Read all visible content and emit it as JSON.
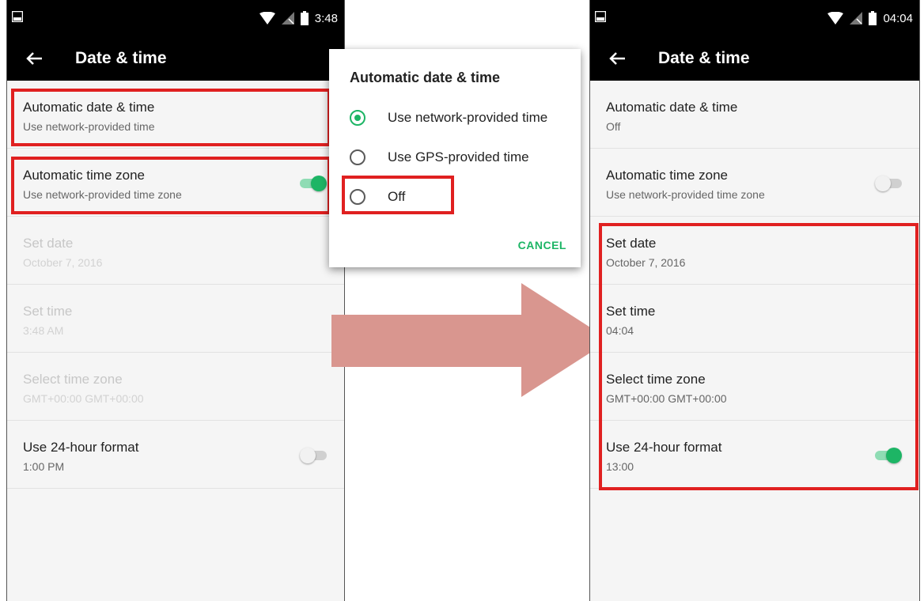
{
  "colors": {
    "accent": "#1db565",
    "highlight": "#e02020",
    "arrow": "#d9968f",
    "statusbar": "#000000"
  },
  "left_screen": {
    "status_time": "3:48",
    "title": "Date & time",
    "items": [
      {
        "title": "Automatic date & time",
        "subtitle": "Use network-provided time"
      },
      {
        "title": "Automatic time zone",
        "subtitle": "Use network-provided time zone",
        "toggle": "on"
      },
      {
        "title": "Set date",
        "subtitle": "October 7, 2016",
        "disabled": true
      },
      {
        "title": "Set time",
        "subtitle": "3:48 AM",
        "disabled": true
      },
      {
        "title": "Select time zone",
        "subtitle": "GMT+00:00 GMT+00:00",
        "disabled": true
      },
      {
        "title": "Use 24-hour format",
        "subtitle": "1:00 PM",
        "toggle": "off"
      }
    ]
  },
  "dialog": {
    "title": "Automatic date & time",
    "options": [
      {
        "label": "Use network-provided time",
        "selected": true
      },
      {
        "label": "Use GPS-provided time",
        "selected": false
      },
      {
        "label": "Off",
        "selected": false
      }
    ],
    "cancel_label": "CANCEL"
  },
  "right_screen": {
    "status_time": "04:04",
    "title": "Date & time",
    "items": [
      {
        "title": "Automatic date & time",
        "subtitle": "Off"
      },
      {
        "title": "Automatic time zone",
        "subtitle": "Use network-provided time zone",
        "toggle": "off"
      },
      {
        "title": "Set date",
        "subtitle": "October 7, 2016"
      },
      {
        "title": "Set time",
        "subtitle": "04:04"
      },
      {
        "title": "Select time zone",
        "subtitle": "GMT+00:00 GMT+00:00"
      },
      {
        "title": "Use 24-hour format",
        "subtitle": "13:00",
        "toggle": "on"
      }
    ]
  }
}
